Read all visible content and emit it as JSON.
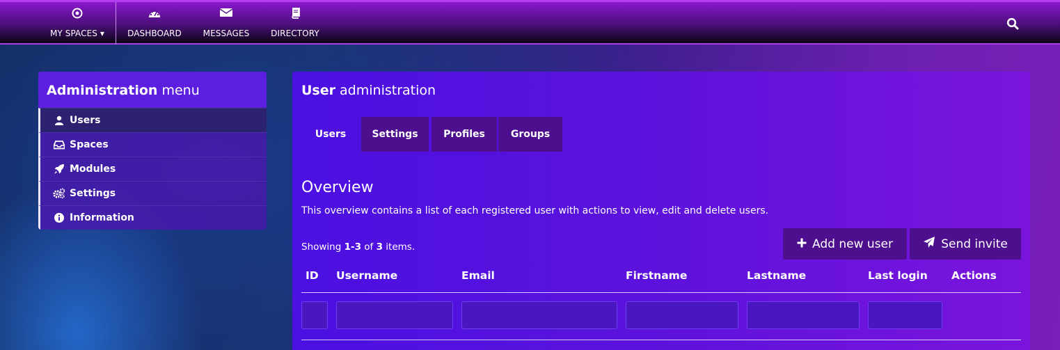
{
  "nav": {
    "items": [
      {
        "label": "MY SPACES",
        "icon": "target-icon"
      },
      {
        "label": "DASHBOARD",
        "icon": "dashboard-icon"
      },
      {
        "label": "MESSAGES",
        "icon": "envelope-icon"
      },
      {
        "label": "DIRECTORY",
        "icon": "book-icon"
      }
    ],
    "search_icon": "search-icon"
  },
  "admin_menu": {
    "title_bold": "Administration",
    "title_light": " menu",
    "items": [
      {
        "label": "Users",
        "icon": "user-icon",
        "active": true
      },
      {
        "label": "Spaces",
        "icon": "inbox-icon",
        "active": false
      },
      {
        "label": "Modules",
        "icon": "rocket-icon",
        "active": false
      },
      {
        "label": "Settings",
        "icon": "gears-icon",
        "active": false
      },
      {
        "label": "Information",
        "icon": "info-icon",
        "active": false
      }
    ]
  },
  "user_admin": {
    "title_bold": "User",
    "title_light": " administration",
    "tabs": [
      {
        "label": "Users",
        "active": true
      },
      {
        "label": "Settings",
        "active": false
      },
      {
        "label": "Profiles",
        "active": false
      },
      {
        "label": "Groups",
        "active": false
      }
    ],
    "heading": "Overview",
    "description": "This overview contains a list of each registered user with actions to view, edit and delete users.",
    "summary": {
      "prefix": "Showing ",
      "range": "1-3",
      "middle": " of ",
      "total": "3",
      "suffix": " items."
    },
    "add_button": "Add new user",
    "invite_button": "Send invite",
    "columns": [
      "ID",
      "Username",
      "Email",
      "Firstname",
      "Lastname",
      "Last login",
      "Actions"
    ]
  },
  "colors": {
    "nav_top": "#8a17cf",
    "panel_accent": "#5c1fe0",
    "button_bg": "#4d0f8e",
    "active_menu": "#2d2270"
  }
}
